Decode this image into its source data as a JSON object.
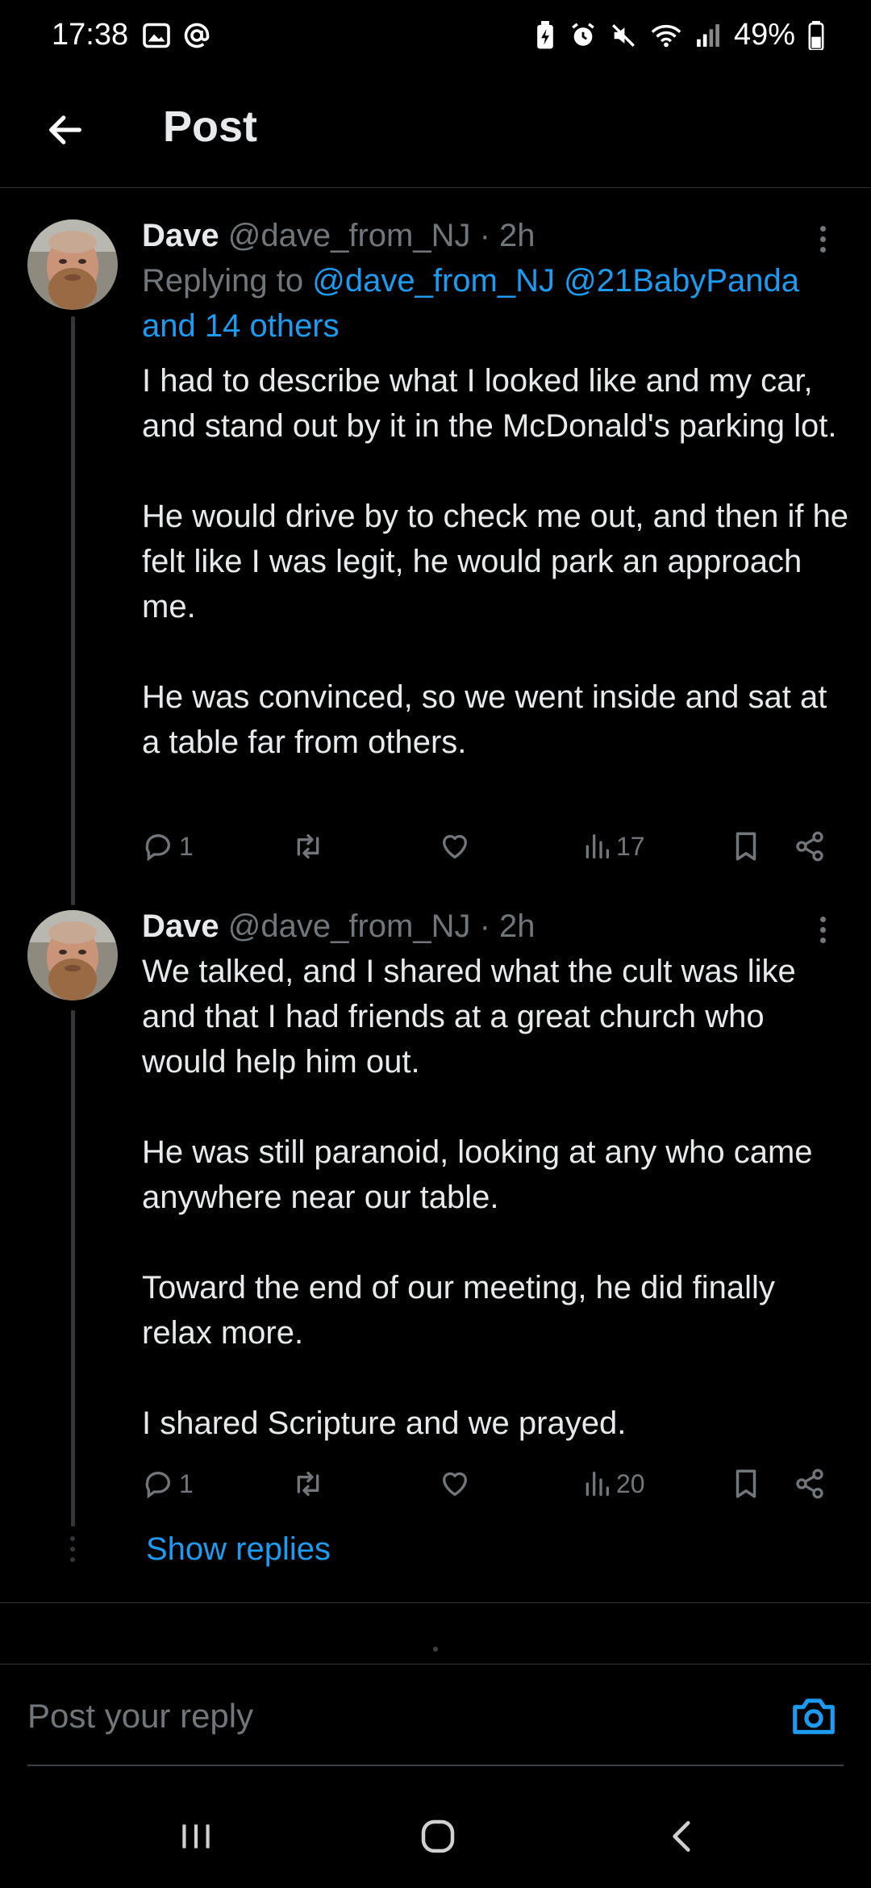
{
  "status_bar": {
    "time": "17:38",
    "battery": "49%"
  },
  "header": {
    "title": "Post"
  },
  "tweets": [
    {
      "name": "Dave",
      "handle": "@dave_from_NJ",
      "time": "· 2h",
      "replying_prefix": "Replying to ",
      "replying_to_1": "@dave_from_NJ",
      "replying_to_2": "@21BabyPanda",
      "replying_to_rest": "and 14 others",
      "text": "I had to describe what I looked like and my car, and stand out by it in the McDonald's parking lot.\n\nHe would drive by to check me out, and then if he felt like I was legit, he would park an approach me.\n\nHe was convinced, so we went inside and sat at a table far from others.",
      "replies": "1",
      "views": "17"
    },
    {
      "name": "Dave",
      "handle": "@dave_from_NJ",
      "time": "· 2h",
      "text": "We talked, and I shared what the cult was like and that I had friends at a great church who would help him out.\n\nHe was still paranoid, looking at any who came anywhere near our table.\n\nToward the end of our meeting, he did finally relax more.\n\nI shared Scripture and we prayed.",
      "replies": "1",
      "views": "20"
    }
  ],
  "show_replies_label": "Show replies",
  "reply_box": {
    "placeholder": "Post your reply"
  },
  "colors": {
    "background": "#000000",
    "accent": "#1d9bf0",
    "secondary_text": "#71767b",
    "primary_text": "#e7e9ea"
  },
  "icons": {
    "back": "arrow-left-icon",
    "more": "more-vertical-icon",
    "reply": "reply-bubble-icon",
    "repost": "repost-icon",
    "like": "heart-icon",
    "views": "bar-chart-icon",
    "bookmark": "bookmark-icon",
    "share": "share-icon",
    "camera": "camera-icon"
  }
}
